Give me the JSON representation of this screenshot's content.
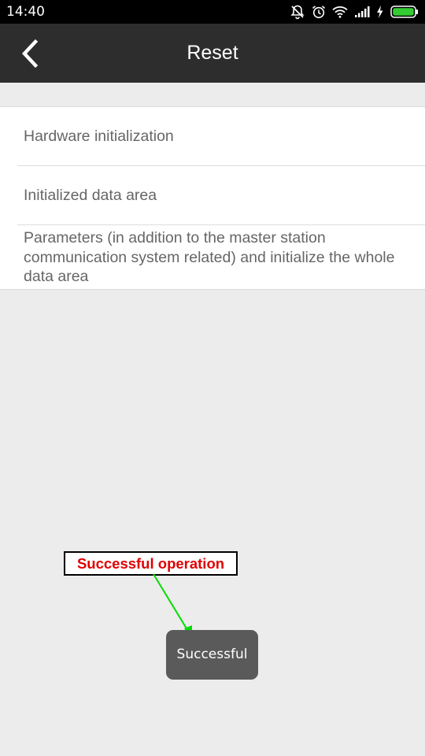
{
  "status_bar": {
    "time": "14:40",
    "icons": [
      "notifications-off-icon",
      "alarm-icon",
      "wifi-icon",
      "signal-icon",
      "charging-icon",
      "battery-icon"
    ],
    "battery_color": "#33cc33"
  },
  "header": {
    "title": "Reset",
    "back_icon": "chevron-left-icon",
    "background": "#2d2d2d"
  },
  "list": {
    "items": [
      {
        "label": "Hardware initialization"
      },
      {
        "label": "Initialized data area"
      },
      {
        "label": "Parameters (in addition to the master station communication system related) and initialize the whole data area"
      }
    ]
  },
  "annotation": {
    "label": "Successful operation",
    "text_color": "#e00000",
    "arrow_color": "#00dd00"
  },
  "toast": {
    "message": "Successful"
  }
}
